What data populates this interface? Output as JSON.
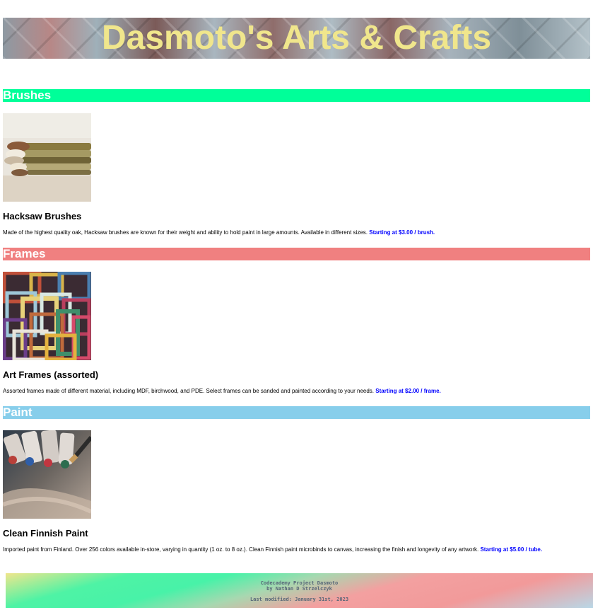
{
  "header": {
    "title": "Dasmoto's Arts & Crafts"
  },
  "sections": [
    {
      "heading": "Brushes",
      "heading_color": "#00ff99",
      "product_name": "Hacksaw Brushes",
      "description": "Made of the highest quality oak, Hacksaw brushes are known for their weight and ability to hold paint in large amounts. Available in different sizes.",
      "price": "Starting at $3.00 / brush."
    },
    {
      "heading": "Frames",
      "heading_color": "#f08080",
      "product_name": "Art Frames (assorted)",
      "description": "Assorted frames made of different material, including MDF, birchwood, and PDE. Select frames can be sanded and painted according to your needs.",
      "price": "Starting at $2.00 / frame."
    },
    {
      "heading": "Paint",
      "heading_color": "#87ceeb",
      "product_name": "Clean Finnish Paint",
      "description": "Imported paint from Finland. Over 256 colors available in-store, varying in quantity (1 oz. to 8 oz.). Clean Finnish paint microbinds to canvas, increasing the finish and longevity of any artwork.",
      "price": "Starting at $5.00 / tube."
    }
  ],
  "images": {
    "brushes": "brushes-photo",
    "frames": "frames-photo",
    "paint": "paint-tubes-photo"
  },
  "footer": {
    "project": "Codecademy Project Dasmoto",
    "author": "by Nathan D Strzelczyk",
    "modified": "Last modified: January 31st, 2023"
  },
  "colors": {
    "title_text": "#f0e68c",
    "price_text": "#0000ff"
  }
}
